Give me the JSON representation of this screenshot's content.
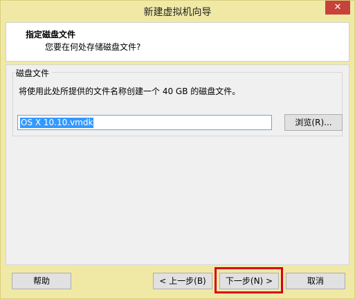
{
  "window": {
    "title": "新建虚拟机向导",
    "close_label": "✕"
  },
  "header": {
    "title": "指定磁盘文件",
    "subtitle": "您要在何处存储磁盘文件?"
  },
  "disk_group": {
    "legend": "磁盘文件",
    "description": "将使用此处所提供的文件名称创建一个 40 GB 的磁盘文件。",
    "filename_value": "OS X 10.10.vmdk",
    "browse_label": "浏览(R)..."
  },
  "footer": {
    "help_label": "帮助",
    "back_label": "< 上一步(B)",
    "next_label": "下一步(N) >",
    "cancel_label": "取消"
  },
  "colors": {
    "window_bg": "#f0e9a6",
    "highlight": "#d8001a",
    "selection": "#3399ff"
  }
}
